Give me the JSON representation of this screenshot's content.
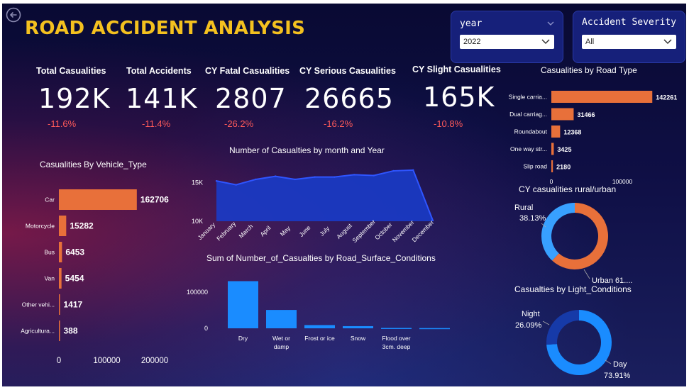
{
  "header": {
    "title": "ROAD ACCIDENT ANALYSIS"
  },
  "filters": {
    "year": {
      "label": "year",
      "value": "2022"
    },
    "severity": {
      "label": "Accident Severity",
      "value": "All"
    }
  },
  "kpis": [
    {
      "label": "Total Casualities",
      "value": "192K",
      "change": "-11.6%"
    },
    {
      "label": "Total Accidents",
      "value": "141K",
      "change": "-11.4%"
    },
    {
      "label": "CY Fatal Casualities",
      "value": "2807",
      "change": "-26.2%"
    },
    {
      "label": "CY Serious Casualities",
      "value": "26665",
      "change": "-16.2%"
    },
    {
      "label": "CY Slight Casualities",
      "value": "165K",
      "change": "-10.8%"
    }
  ],
  "colors": {
    "orange": "#e8703a",
    "blue": "#1a8cff",
    "navy": "#163aa8",
    "title": "#f4c11f",
    "negative": "#ff5a5a"
  },
  "chart_data": [
    {
      "type": "bar",
      "orientation": "horizontal",
      "title": "Casualities By Vehicle_Type",
      "categories": [
        "Car",
        "Motorcycle",
        "Bus",
        "Van",
        "Other vehi...",
        "Agricultura..."
      ],
      "values": [
        162706,
        15282,
        6453,
        5454,
        1417,
        388
      ],
      "value_labels": [
        "162706",
        "15282",
        "6453",
        "5454",
        "1417",
        "388"
      ],
      "xticks": [
        "0",
        "100000",
        "200000"
      ],
      "xlim": [
        0,
        200000
      ]
    },
    {
      "type": "area",
      "title": "Number of Casualties by month and Year",
      "x": [
        "January",
        "February",
        "March",
        "April",
        "May",
        "June",
        "July",
        "August",
        "September",
        "October",
        "November",
        "December"
      ],
      "values": [
        15200,
        14700,
        15400,
        15800,
        15400,
        15700,
        15700,
        16000,
        15900,
        16500,
        16600,
        10100
      ],
      "yticks": [
        "10K",
        "15K"
      ],
      "ylim": [
        10000,
        17500
      ]
    },
    {
      "type": "bar",
      "title": "Sum of Number_of_Casualties by Road_Surface_Conditions",
      "categories": [
        "Dry",
        "Wet or damp",
        "Frost or ice",
        "Snow",
        "Flood over 3cm. deep"
      ],
      "values": [
        131000,
        51000,
        9000,
        6000,
        1000
      ],
      "yticks": [
        "0",
        "100000"
      ],
      "ylim": [
        0,
        130000
      ]
    },
    {
      "type": "bar",
      "orientation": "horizontal",
      "title": "Casualities by Road Type",
      "categories": [
        "Single carria...",
        "Dual carriag...",
        "Roundabout",
        "One way str...",
        "Slip road"
      ],
      "values": [
        142261,
        31466,
        12368,
        3425,
        2180
      ],
      "value_labels": [
        "142261",
        "31466",
        "12368",
        "3425",
        "2180"
      ],
      "xticks": [
        "0",
        "100000"
      ],
      "xlim": [
        0,
        150000
      ]
    },
    {
      "type": "pie",
      "title": "CY casualities rural/urban",
      "slices": [
        {
          "name": "Rural",
          "value": 38.13,
          "pct_label": "38.13%"
        },
        {
          "name": "Urban",
          "value": 61.87,
          "pct_label": "Urban 61...."
        }
      ]
    },
    {
      "type": "pie",
      "title": "Casualties by Light_Conditions",
      "slices": [
        {
          "name": "Night",
          "value": 26.09,
          "pct_label": "26.09%"
        },
        {
          "name": "Day",
          "value": 73.91,
          "pct_label": "73.91%"
        }
      ]
    }
  ]
}
